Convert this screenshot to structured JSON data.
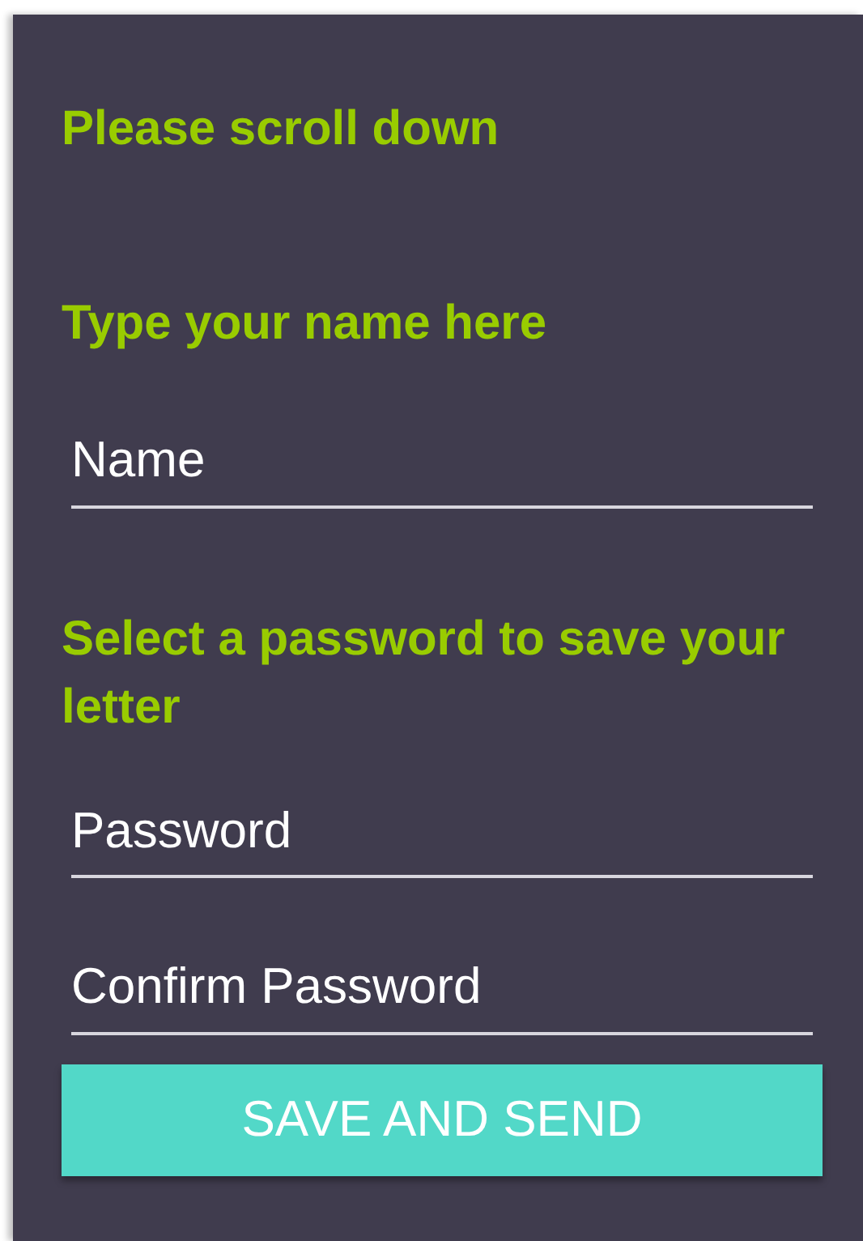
{
  "headings": [
    {
      "text": "Please scroll down"
    },
    {
      "text": "Type your name here"
    }
  ],
  "name_field": {
    "placeholder": "Name"
  },
  "password_heading": {
    "text": "Select a password to save your letter"
  },
  "password_fields": [
    {
      "placeholder": "Password"
    },
    {
      "placeholder": "Confirm Password"
    }
  ],
  "submit_button": {
    "label": "SAVE AND SEND"
  }
}
